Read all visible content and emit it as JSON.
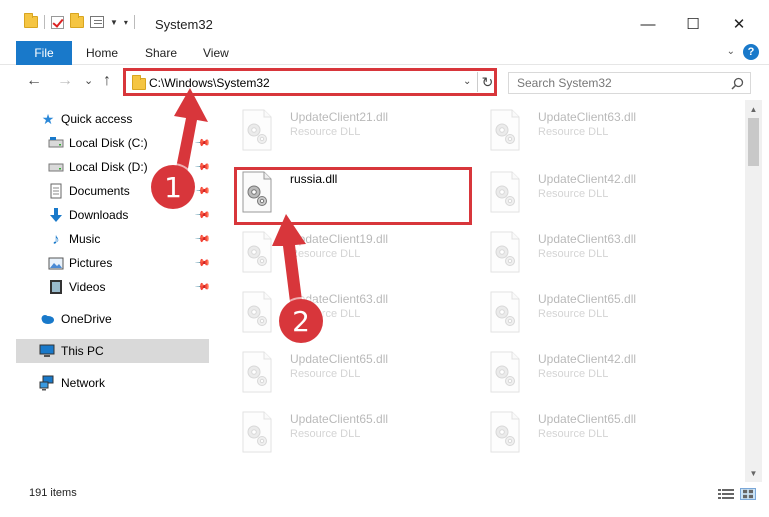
{
  "window": {
    "title": "System32",
    "minimize": "—",
    "maximize": "☐",
    "close": "✕"
  },
  "ribbon": {
    "file": "File",
    "tabs": [
      "Home",
      "Share",
      "View"
    ],
    "help": "?"
  },
  "nav": {
    "back": "←",
    "forward": "→",
    "recent": "⌄",
    "up": "↑"
  },
  "address": {
    "path": "C:\\Windows\\System32",
    "dropdown": "⌄",
    "refresh": "↻"
  },
  "search": {
    "placeholder": "Search System32"
  },
  "sidebar": {
    "items": [
      {
        "label": "Quick access",
        "icon": "star-icon"
      },
      {
        "label": "Local Disk (C:)",
        "icon": "drive-icon"
      },
      {
        "label": "Local Disk (D:)",
        "icon": "drive-icon"
      },
      {
        "label": "Documents",
        "icon": "documents-icon"
      },
      {
        "label": "Downloads",
        "icon": "download-icon"
      },
      {
        "label": "Music",
        "icon": "music-icon"
      },
      {
        "label": "Pictures",
        "icon": "pictures-icon"
      },
      {
        "label": "Videos",
        "icon": "videos-icon"
      },
      {
        "label": "OneDrive",
        "icon": "cloud-icon"
      },
      {
        "label": "This PC",
        "icon": "computer-icon"
      },
      {
        "label": "Network",
        "icon": "network-icon"
      }
    ]
  },
  "files": {
    "left": [
      {
        "name": "UpdateClient21.dll",
        "type": "Resource DLL"
      },
      {
        "name": "russia.dll",
        "type": ""
      },
      {
        "name": "UpdateClient19.dll",
        "type": "Resource DLL"
      },
      {
        "name": "UpdateClient63.dll",
        "type": "Resource DLL"
      },
      {
        "name": "UpdateClient65.dll",
        "type": "Resource DLL"
      },
      {
        "name": "UpdateClient65.dll",
        "type": "Resource DLL"
      }
    ],
    "right": [
      {
        "name": "UpdateClient63.dll",
        "type": "Resource DLL"
      },
      {
        "name": "UpdateClient42.dll",
        "type": "Resource DLL"
      },
      {
        "name": "UpdateClient63.dll",
        "type": "Resource DLL"
      },
      {
        "name": "UpdateClient65.dll",
        "type": "Resource DLL"
      },
      {
        "name": "UpdateClient42.dll",
        "type": "Resource DLL"
      },
      {
        "name": "UpdateClient65.dll",
        "type": "Resource DLL"
      }
    ]
  },
  "status": {
    "items": "191 items"
  },
  "annotations": {
    "step1": "1",
    "step2": "2",
    "color": "#d8363b"
  }
}
